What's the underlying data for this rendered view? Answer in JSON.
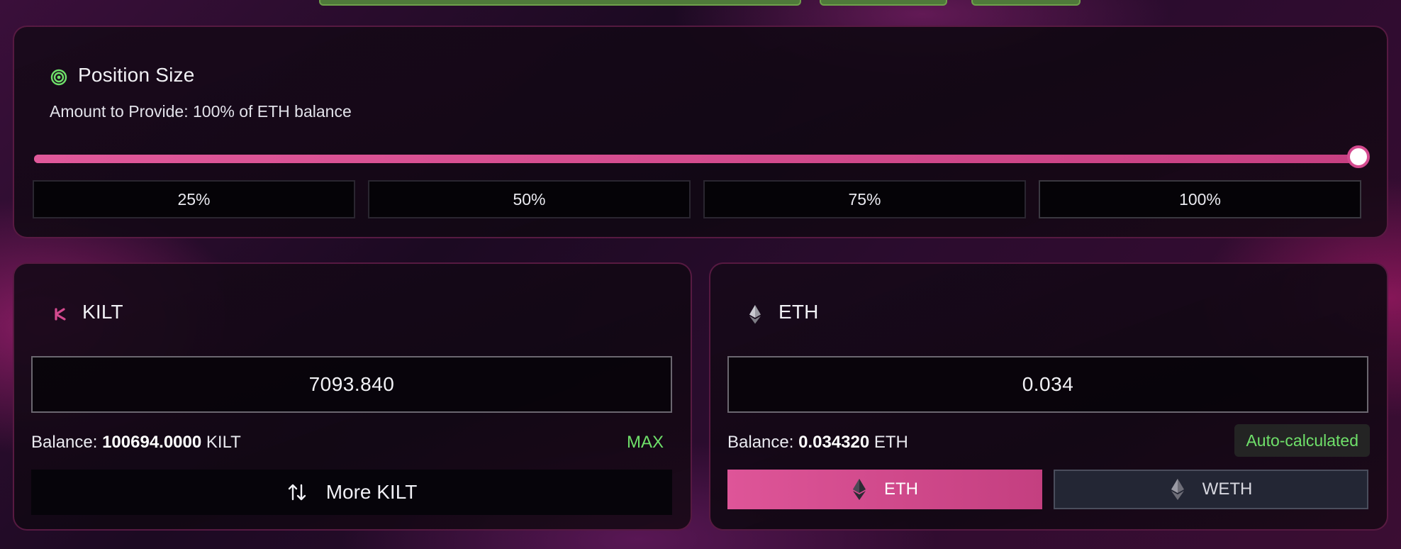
{
  "position": {
    "title": "Position Size",
    "amount_label": "Amount to Provide: 100% of ETH balance",
    "slider_value": 1.0,
    "presets": [
      "25%",
      "50%",
      "75%",
      "100%"
    ],
    "active_preset": "100%"
  },
  "kilt": {
    "symbol": "KILT",
    "amount": "7093.840",
    "balance_label": "Balance:",
    "balance_value": "100694.0000",
    "balance_unit": "KILT",
    "max_label": "MAX",
    "more_label": "More KILT"
  },
  "eth": {
    "symbol": "ETH",
    "amount": "0.034",
    "balance_label": "Balance:",
    "balance_value": "0.034320",
    "balance_unit": "ETH",
    "auto_label": "Auto-calculated",
    "toggle_eth": "ETH",
    "toggle_weth": "WETH"
  },
  "colors": {
    "accent_pink": "#d44a8f",
    "accent_green": "#6fe06a"
  },
  "icons": {
    "position": "target-icon",
    "kilt": "kilt-logo-icon",
    "eth": "ethereum-icon",
    "swap": "swap-vertical-icon"
  }
}
